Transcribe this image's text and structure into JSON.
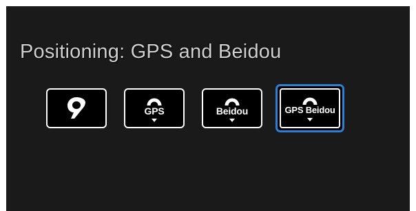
{
  "title": "Positioning: GPS and Beidou",
  "options": [
    {
      "label": "",
      "icon": "location-pin-icon",
      "selected": false
    },
    {
      "label": "GPS",
      "icon": "satellite-arc-icon",
      "selected": false
    },
    {
      "label": "Beidou",
      "icon": "satellite-arc-icon",
      "selected": false
    },
    {
      "label": "GPS Beidou",
      "icon": "satellite-arc-icon",
      "selected": true
    }
  ],
  "colors": {
    "background": "#1a1a1a",
    "selected_outline": "#2f7fd6",
    "button_border": "#ffffff",
    "title_text": "#d0d0d0"
  }
}
